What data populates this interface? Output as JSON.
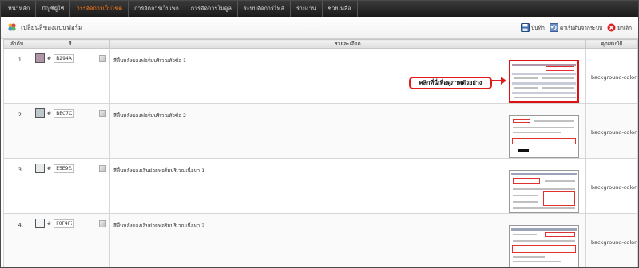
{
  "nav": {
    "items": [
      {
        "label": "หน้าหลัก",
        "active": false
      },
      {
        "label": "บัญชีผู้ใช้",
        "active": false
      },
      {
        "label": "การจัดการเว็บไซต์",
        "active": true
      },
      {
        "label": "การจัดการเว็บเพจ",
        "active": false
      },
      {
        "label": "การจัดการโมดูล",
        "active": false
      },
      {
        "label": "ระบบจัดการไฟล์",
        "active": false
      },
      {
        "label": "รายงาน",
        "active": false
      },
      {
        "label": "ช่วยเหลือ",
        "active": false
      }
    ]
  },
  "page": {
    "title": "เปลี่ยนสีของแบบฟอร์ม",
    "title_icon": "palette-icon"
  },
  "toolbar": {
    "save_label": "บันทึก",
    "reset_label": "ค่าเริ่มต้นจากระบบ",
    "cancel_label": "ยกเลิก"
  },
  "table": {
    "headers": {
      "index": "ลำดับ",
      "color": "สี",
      "details": "รายละเอียด",
      "property": "คุณสมบัติ"
    },
    "rows": [
      {
        "index": "1.",
        "hex": "B294A8",
        "swatch": "#b294a8",
        "description": "สีพื้นหลังของฟอร์มบริเวณหัวข้อ 1",
        "property": "background-color"
      },
      {
        "index": "2.",
        "hex": "BEC7CA",
        "swatch": "#bec7ca",
        "description": "สีพื้นหลังของฟอร์มบริเวณหัวข้อ 2",
        "property": "background-color"
      },
      {
        "index": "3.",
        "hex": "E5E9EA",
        "swatch": "#e5e9ea",
        "description": "สีพื้นหลังของเสิบย่อยฟอร์มบริเวณเนื้อหา 1",
        "property": "background-color"
      },
      {
        "index": "4.",
        "hex": "F0F4F7",
        "swatch": "#f0f4f7",
        "description": "สีพื้นหลังของเสิบย่อยฟอร์มบริเวณเนื้อหา 2",
        "property": "background-color"
      }
    ]
  },
  "hash_symbol": "#",
  "callout": {
    "text": "คลิกที่นี่เพื่อดูภาพตัวอย่าง"
  },
  "colors": {
    "active_nav": "#ff7a1a",
    "callout_border": "#e01b1b"
  }
}
